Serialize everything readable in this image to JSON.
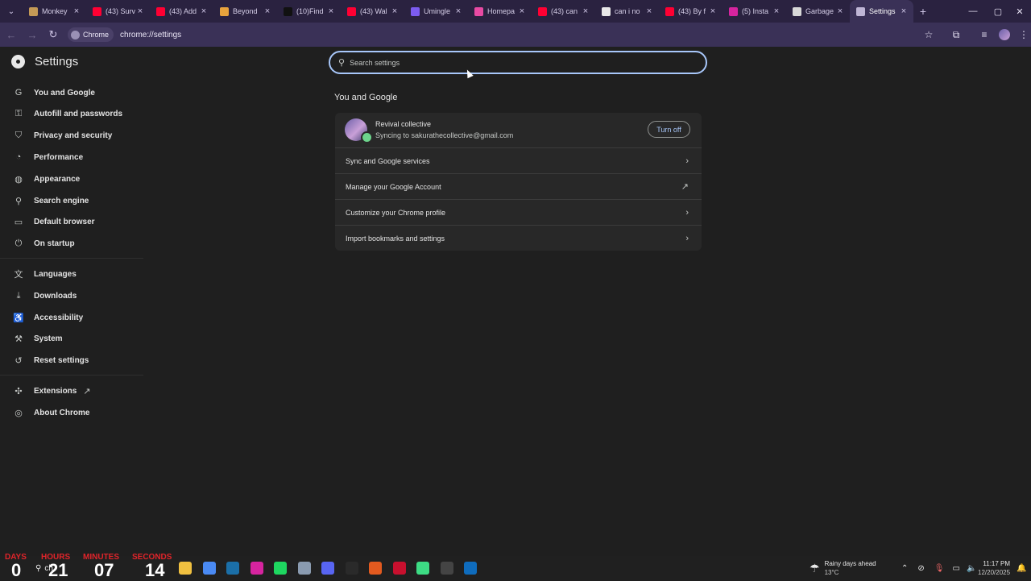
{
  "tabs": [
    {
      "title": "Monkey",
      "color": "#c59a56"
    },
    {
      "title": "(43) Surv",
      "color": "#ff0033"
    },
    {
      "title": "(43) Add",
      "color": "#ff0033"
    },
    {
      "title": "Beyond",
      "color": "#e8a33d"
    },
    {
      "title": "(10)Find",
      "color": "#111111"
    },
    {
      "title": "(43) Wal",
      "color": "#ff0033"
    },
    {
      "title": "Umingle",
      "color": "#7c5cf0"
    },
    {
      "title": "Homepa",
      "color": "#e84aa3"
    },
    {
      "title": "(43) can",
      "color": "#ff0033"
    },
    {
      "title": "can i no",
      "color": "#e8e8e8"
    },
    {
      "title": "(43) By f",
      "color": "#ff0033"
    },
    {
      "title": "(5) Insta",
      "color": "#d6249f"
    },
    {
      "title": "Garbage",
      "color": "#d8d8d8"
    },
    {
      "title": "Settings",
      "color": "#bfb6d6",
      "active": true
    }
  ],
  "toolbar": {
    "site_chip": "Chrome",
    "url": "chrome://settings"
  },
  "sidebar": {
    "title": "Settings",
    "groups": [
      [
        {
          "label": "You and Google",
          "icon": "google-g-icon",
          "glyph": "G"
        },
        {
          "label": "Autofill and passwords",
          "icon": "key-icon",
          "glyph": "⚿"
        },
        {
          "label": "Privacy and security",
          "icon": "shield-icon",
          "glyph": "⛉"
        },
        {
          "label": "Performance",
          "icon": "speedometer-icon",
          "glyph": "◔"
        },
        {
          "label": "Appearance",
          "icon": "palette-icon",
          "glyph": "◍"
        },
        {
          "label": "Search engine",
          "icon": "search-icon",
          "glyph": "⚲"
        },
        {
          "label": "Default browser",
          "icon": "browser-icon",
          "glyph": "▭"
        },
        {
          "label": "On startup",
          "icon": "power-icon",
          "glyph": "⏻"
        }
      ],
      [
        {
          "label": "Languages",
          "icon": "translate-icon",
          "glyph": "文"
        },
        {
          "label": "Downloads",
          "icon": "download-icon",
          "glyph": "⤓"
        },
        {
          "label": "Accessibility",
          "icon": "accessibility-icon",
          "glyph": "♿"
        },
        {
          "label": "System",
          "icon": "wrench-icon",
          "glyph": "⚒"
        },
        {
          "label": "Reset settings",
          "icon": "reset-icon",
          "glyph": "↺"
        }
      ],
      [
        {
          "label": "Extensions",
          "icon": "puzzle-icon",
          "glyph": "✣",
          "external": true
        },
        {
          "label": "About Chrome",
          "icon": "chrome-icon",
          "glyph": "◎"
        }
      ]
    ]
  },
  "search": {
    "placeholder": "Search settings"
  },
  "main": {
    "section_title": "You and Google",
    "account": {
      "name": "Revival collective",
      "email": "Syncing to sakurathecollective@gmail.com",
      "button": "Turn off"
    },
    "rows": [
      {
        "label": "Sync and Google services",
        "icon": "chevron-right-icon",
        "glyph": "›"
      },
      {
        "label": "Manage your Google Account",
        "icon": "external-link-icon",
        "glyph": "↗"
      },
      {
        "label": "Customize your Chrome profile",
        "icon": "chevron-right-icon",
        "glyph": "›"
      },
      {
        "label": "Import bookmarks and settings",
        "icon": "chevron-right-icon",
        "glyph": "›"
      }
    ]
  },
  "countdown": {
    "labels": [
      "DAYS",
      "HOURS",
      "MINUTES",
      "SECONDS"
    ],
    "values": [
      "0",
      "21",
      "07",
      "14"
    ]
  },
  "taskbar": {
    "search_text": "ch",
    "apps": [
      {
        "name": "file-explorer-icon",
        "color": "#f0c040"
      },
      {
        "name": "chrome-icon",
        "color": "#4a8af4"
      },
      {
        "name": "steam-icon",
        "color": "#1b6fa8"
      },
      {
        "name": "instagram-icon",
        "color": "#d6249f"
      },
      {
        "name": "spotify-icon",
        "color": "#1ed760"
      },
      {
        "name": "settings-icon",
        "color": "#8a9bb0"
      },
      {
        "name": "discord-icon",
        "color": "#5865f2"
      },
      {
        "name": "capcut-icon",
        "color": "#2a2a2a"
      },
      {
        "name": "game-icon",
        "color": "#e35a1f"
      },
      {
        "name": "video-editor-icon",
        "color": "#c8102e"
      },
      {
        "name": "android-studio-icon",
        "color": "#3ddc84"
      },
      {
        "name": "obs-icon",
        "color": "#444444"
      },
      {
        "name": "outlook-icon",
        "color": "#0f6cbd"
      }
    ],
    "weather_title": "Rainy days ahead",
    "weather_temp": "13°C",
    "time": "11:17 PM",
    "date": "12/20/2025"
  }
}
